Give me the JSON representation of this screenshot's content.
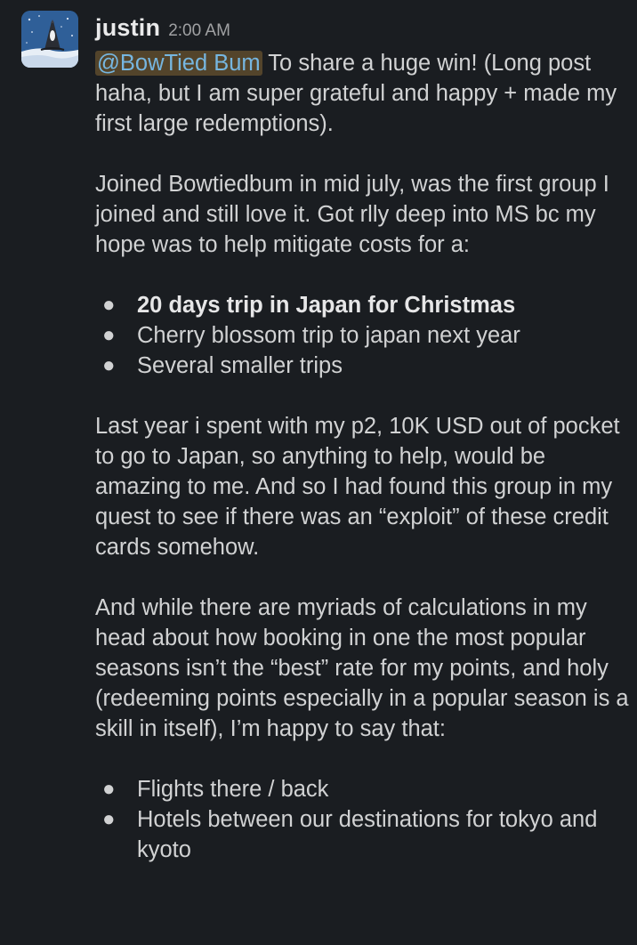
{
  "message": {
    "avatar_icon": "seal-on-ice-avatar",
    "username": "justin",
    "timestamp": "2:00 AM",
    "mention": "@BowTied Bum",
    "intro": " To share a huge win! (Long post haha, but I am super grateful and happy + made my first large redemptions).",
    "para2": "Joined Bowtiedbum in mid july, was the first group I joined and still love it. Got rlly deep into MS bc my hope was to help mitigate costs for a:",
    "list1": [
      "20 days trip in Japan for Christmas",
      "Cherry blossom trip to japan next year",
      "Several smaller trips"
    ],
    "para3": "Last year i spent with my p2, 10K USD out of pocket to go to Japan, so anything to help, would be amazing to me. And so I had found this group in my quest to see if there was an “exploit” of these credit cards somehow.",
    "para4": "And while there are myriads of calculations in my head about how booking in one the most popular seasons isn’t the “best” rate for my points, and holy (redeeming points especially in a popular season is a skill in itself), I’m happy to say that:",
    "list2": [
      "Flights there / back",
      "Hotels between our destinations for tokyo and kyoto"
    ]
  },
  "colors": {
    "background": "#1a1d21",
    "text": "#d1d2d3",
    "mention_text": "#76b6e0",
    "mention_bg": "#e8ab47"
  }
}
